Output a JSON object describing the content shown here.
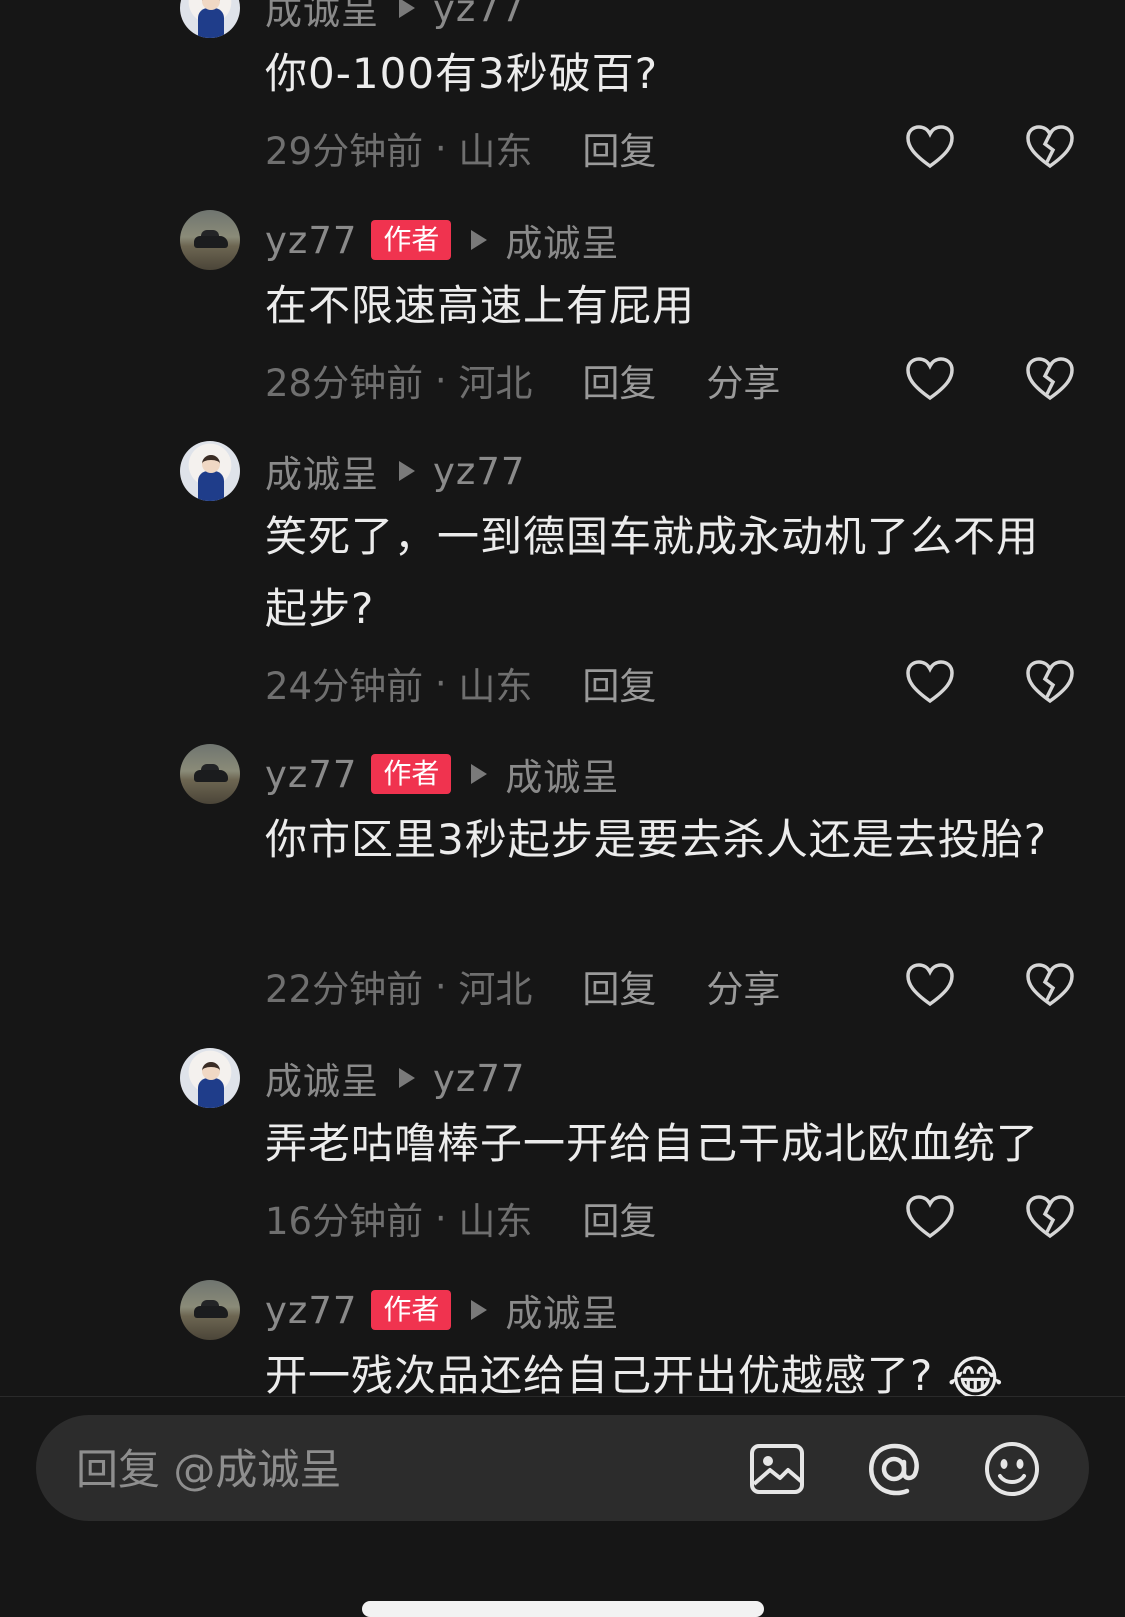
{
  "comments": [
    {
      "author": "成诚呈",
      "is_author": false,
      "reply_to": "yz77",
      "text": "你0-100有3秒破百?",
      "time": "29分钟前",
      "location": "山东",
      "reply": "回复",
      "share": "",
      "avatar": "kid"
    },
    {
      "author": "yz77",
      "is_author": true,
      "badge": "作者",
      "reply_to": "成诚呈",
      "text": "在不限速高速上有屁用",
      "time": "28分钟前",
      "location": "河北",
      "reply": "回复",
      "share": "分享",
      "avatar": "car"
    },
    {
      "author": "成诚呈",
      "is_author": false,
      "reply_to": "yz77",
      "text": "笑死了，一到德国车就成永动机了么不用起步?",
      "time": "24分钟前",
      "location": "山东",
      "reply": "回复",
      "share": "",
      "avatar": "kid"
    },
    {
      "author": "yz77",
      "is_author": true,
      "badge": "作者",
      "reply_to": "成诚呈",
      "text": "你市区里3秒起步是要去杀人还是去投胎?",
      "time": "22分钟前",
      "location": "河北",
      "reply": "回复",
      "share": "分享",
      "avatar": "car"
    },
    {
      "author": "成诚呈",
      "is_author": false,
      "reply_to": "yz77",
      "text": "弄老咕噜棒子一开给自己干成北欧血统了",
      "time": "16分钟前",
      "location": "山东",
      "reply": "回复",
      "share": "",
      "avatar": "kid"
    },
    {
      "author": "yz77",
      "is_author": true,
      "badge": "作者",
      "reply_to": "成诚呈",
      "text": "开一残次品还给自己开出优越感了?",
      "emoji": "😂",
      "avatar": "car"
    }
  ],
  "reply_bar": {
    "placeholder": "回复 @成诚呈",
    "icons": [
      "image-icon",
      "at-icon",
      "emoji-icon"
    ]
  },
  "colors": {
    "background": "#161616",
    "badge": "#f0334f",
    "muted": "#6f6f6f",
    "text": "#ececec"
  }
}
